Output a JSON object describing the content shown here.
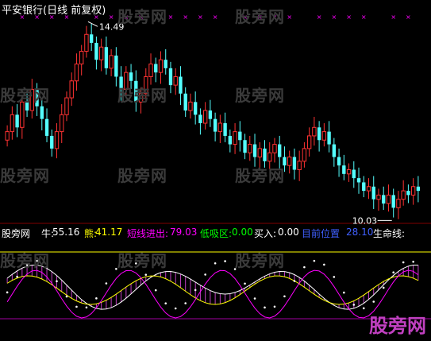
{
  "title": "平安银行(日线 前复权)",
  "indicator_bar": {
    "name": "股旁网",
    "items": [
      {
        "label": "牛:",
        "value": "55.16",
        "color": "#ffffff"
      },
      {
        "label": "熊:",
        "value": "41.17",
        "color": "#ffff00"
      },
      {
        "label": "短线进出:",
        "value": "79.03",
        "color": "#ff00ff"
      },
      {
        "label": "低吸区:",
        "value": "0.00",
        "color": "#00ff00"
      },
      {
        "label": "买入:",
        "value": "0.00",
        "color": "#ffffff"
      },
      {
        "label": "目前位置",
        "value": "28.10",
        "color": "#4060ff"
      },
      {
        "label": "生命线:",
        "value": "",
        "color": "#ffffff"
      }
    ]
  },
  "watermark": "股旁网",
  "corner_logo": "股旁网",
  "colors": {
    "up": "#ff3232",
    "down": "#54ffff",
    "bg": "#000000",
    "marker": "#ff00ff",
    "hline_yellow": "#ffff00",
    "hline_purple": "#a000a0"
  },
  "chart_data": [
    {
      "type": "candlestick",
      "title": "平安银行(日线 前复权)",
      "annotations": [
        {
          "text": "14.49",
          "kind": "high"
        },
        {
          "text": "10.03",
          "kind": "low"
        }
      ],
      "close": [
        11.9,
        12.3,
        12.0,
        12.6,
        12.4,
        12.9,
        12.5,
        12.2,
        11.8,
        11.5,
        11.9,
        12.3,
        12.7,
        13.1,
        13.5,
        13.8,
        14.2,
        14.0,
        13.6,
        13.9,
        13.4,
        13.7,
        13.2,
        12.9,
        13.3,
        13.1,
        12.6,
        12.8,
        13.2,
        13.5,
        13.3,
        13.6,
        13.4,
        13.0,
        13.2,
        12.8,
        12.4,
        12.6,
        12.3,
        12.1,
        12.4,
        12.2,
        11.9,
        12.1,
        11.8,
        11.6,
        11.9,
        11.7,
        11.4,
        11.6,
        11.3,
        11.5,
        11.2,
        11.4,
        11.6,
        11.3,
        11.1,
        11.3,
        11.0,
        11.2,
        11.5,
        11.8,
        12.0,
        11.7,
        11.9,
        11.6,
        11.3,
        11.1,
        10.9,
        11.0,
        10.8,
        10.7,
        10.5,
        10.6,
        10.3,
        10.4,
        10.2,
        10.4,
        10.1,
        10.3,
        10.5,
        10.4,
        10.6,
        10.5
      ]
    },
    {
      "type": "line",
      "hlines": [
        {
          "color": "yellow"
        },
        {
          "color": "purple"
        }
      ]
    }
  ]
}
